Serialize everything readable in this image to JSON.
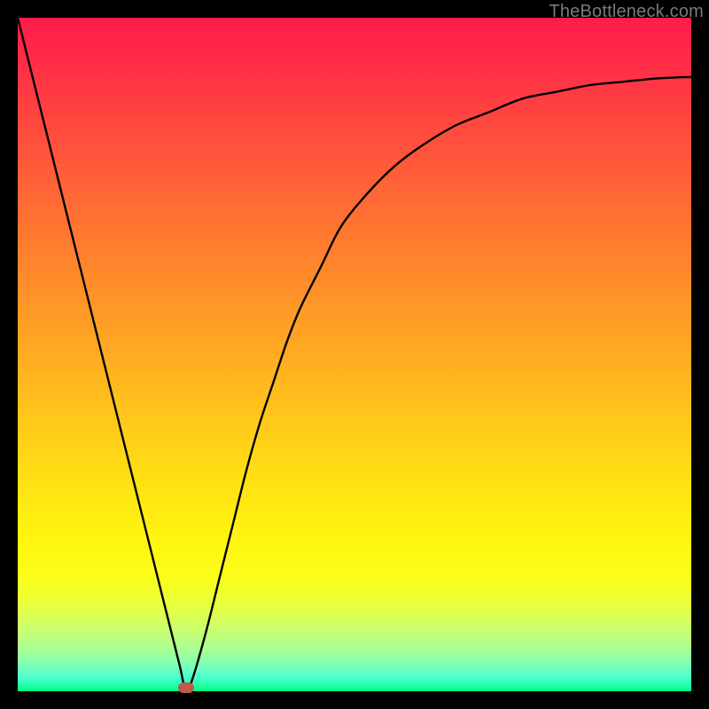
{
  "watermark": "TheBottleneck.com",
  "chart_data": {
    "type": "line",
    "x": [
      0.0,
      0.02,
      0.04,
      0.06,
      0.08,
      0.1,
      0.12,
      0.14,
      0.16,
      0.18,
      0.2,
      0.22,
      0.24,
      0.25,
      0.26,
      0.28,
      0.3,
      0.32,
      0.34,
      0.36,
      0.38,
      0.4,
      0.42,
      0.45,
      0.48,
      0.52,
      0.56,
      0.6,
      0.65,
      0.7,
      0.75,
      0.8,
      0.85,
      0.9,
      0.95,
      1.0
    ],
    "values": [
      1.0,
      0.92,
      0.84,
      0.76,
      0.68,
      0.6,
      0.52,
      0.44,
      0.36,
      0.28,
      0.2,
      0.12,
      0.04,
      0.0,
      0.02,
      0.09,
      0.17,
      0.25,
      0.33,
      0.4,
      0.46,
      0.52,
      0.57,
      0.63,
      0.69,
      0.74,
      0.78,
      0.81,
      0.84,
      0.86,
      0.88,
      0.89,
      0.9,
      0.905,
      0.91,
      0.912
    ],
    "title": "",
    "xlabel": "",
    "ylabel": "",
    "xlim": [
      0,
      1
    ],
    "ylim": [
      0,
      1
    ],
    "marker": {
      "x": 0.25,
      "y": 0.0
    },
    "notes": "Values are normalized. y=0 is the bottom (green) edge of the plot, y=1 the top (red). The curve descends steeply, touches zero near x≈0.25, then rises and asymptotically flattens."
  },
  "colors": {
    "curve": "#000000",
    "marker": "#c05a4a",
    "frame": "#000000"
  }
}
